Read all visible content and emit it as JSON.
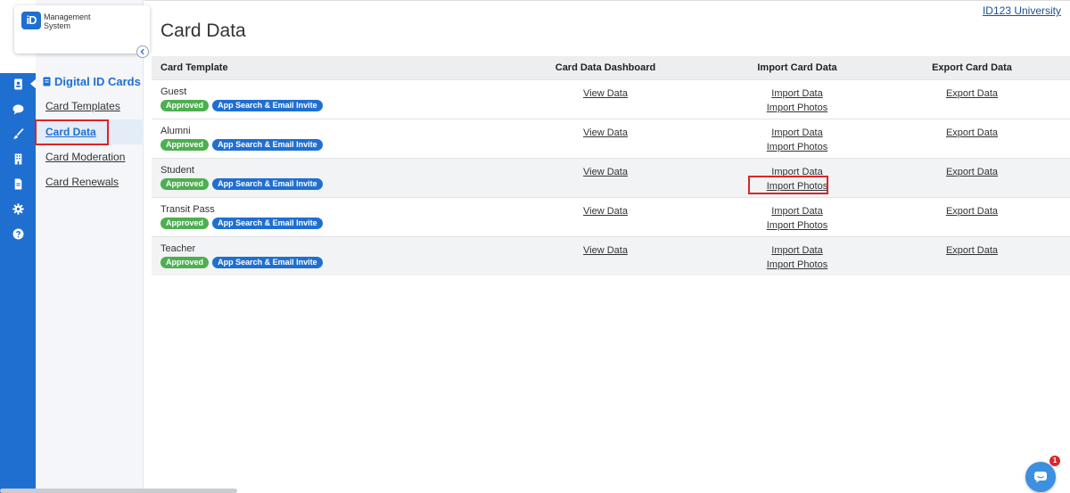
{
  "app": {
    "logo_badge": "iD",
    "logo_line1": "Management",
    "logo_line2": "System",
    "org_link": "ID123 University"
  },
  "rail": {
    "icons": [
      "id-card-icon",
      "chat-icon",
      "paint-brush-icon",
      "building-icon",
      "document-icon",
      "gear-icon",
      "help-icon"
    ],
    "active_index": 0
  },
  "subnav": {
    "heading": "Digital ID Cards",
    "items": [
      {
        "label": "Card Templates",
        "active": false
      },
      {
        "label": "Card Data",
        "active": true
      },
      {
        "label": "Card Moderation",
        "active": false
      },
      {
        "label": "Card Renewals",
        "active": false
      }
    ]
  },
  "page": {
    "title": "Card Data"
  },
  "table": {
    "headers": [
      "Card Template",
      "Card Data Dashboard",
      "Import Card Data",
      "Export Card Data"
    ],
    "rows": [
      {
        "name": "Guest",
        "status": "Approved",
        "method": "App Search & Email Invite",
        "view": "View Data",
        "import_data": "Import Data",
        "import_photos": "Import Photos",
        "export": "Export Data"
      },
      {
        "name": "Alumni",
        "status": "Approved",
        "method": "App Search & Email Invite",
        "view": "View Data",
        "import_data": "Import Data",
        "import_photos": "Import Photos",
        "export": "Export Data"
      },
      {
        "name": "Student",
        "status": "Approved",
        "method": "App Search & Email Invite",
        "view": "View Data",
        "import_data": "Import Data",
        "import_photos": "Import Photos",
        "export": "Export Data"
      },
      {
        "name": "Transit Pass",
        "status": "Approved",
        "method": "App Search & Email Invite",
        "view": "View Data",
        "import_data": "Import Data",
        "import_photos": "Import Photos",
        "export": "Export Data"
      },
      {
        "name": "Teacher",
        "status": "Approved",
        "method": "App Search & Email Invite",
        "view": "View Data",
        "import_data": "Import Data",
        "import_photos": "Import Photos",
        "export": "Export Data"
      }
    ]
  },
  "chat": {
    "unread_count": "1"
  },
  "colors": {
    "brand_blue": "#1f6fd1",
    "approved_green": "#4caf50",
    "highlight_red": "#d9262b"
  }
}
